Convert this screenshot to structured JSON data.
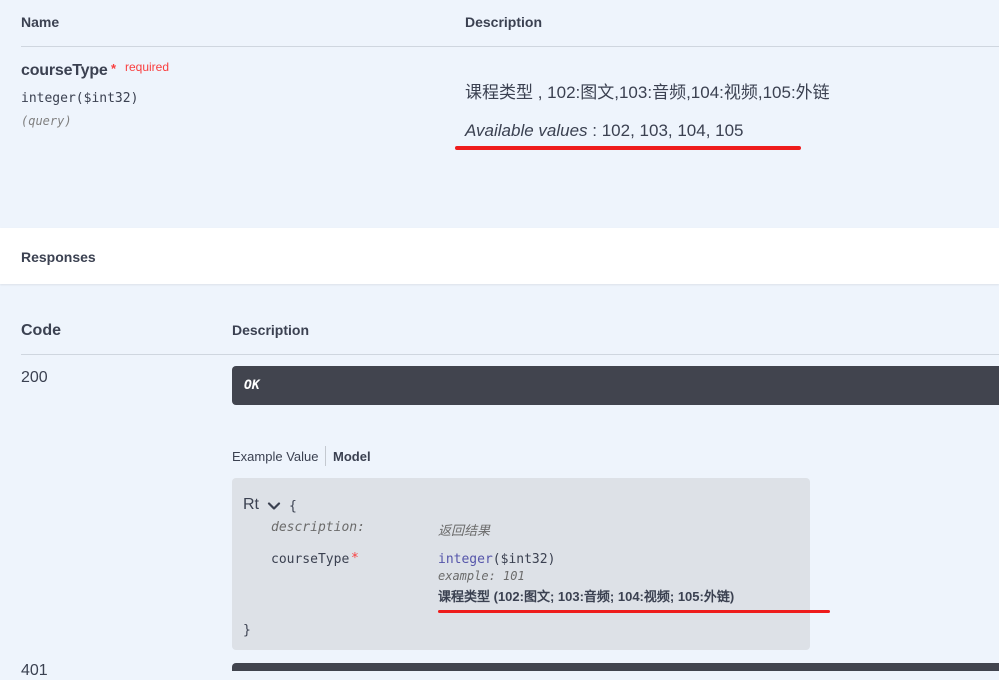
{
  "params": {
    "header_name": "Name",
    "header_description": "Description",
    "param": {
      "name": "courseType",
      "required_star": "*",
      "required_label": "required",
      "type": "integer($int32)",
      "location": "(query)",
      "description": "课程类型 , 102:图文,103:音频,104:视频,105:外链",
      "available_label": "Available values",
      "available_sep": " : ",
      "available_values": "102, 103, 104, 105"
    }
  },
  "responses": {
    "title": "Responses",
    "header_code": "Code",
    "header_description": "Description",
    "items": [
      {
        "code": "200",
        "description": "OK",
        "tabs": {
          "example": "Example Value",
          "model": "Model"
        },
        "model": {
          "name": "Rt",
          "open_brace": "{",
          "close_brace": "}",
          "description_key": "description:",
          "description_value": "返回结果",
          "field_key": "courseType",
          "field_star": "*",
          "field_type_kw": "integer",
          "field_type_fmt": "($int32)",
          "field_example": "example: 101",
          "field_note": "课程类型 (102:图文; 103:音频; 104:视频; 105:外链)"
        }
      },
      {
        "code": "401"
      }
    ]
  },
  "annotations": {
    "underline_color": "#ee1c1c"
  }
}
